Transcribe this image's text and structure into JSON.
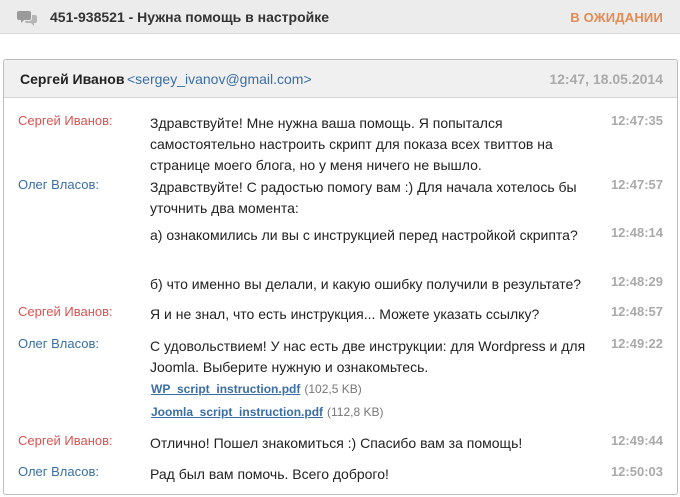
{
  "ticket": {
    "icon": "chat-icon",
    "title": "451-938521 - Нужна помощь в настройке",
    "status": "В ОЖИДАНИИ",
    "status_color": "#e58a55"
  },
  "email_header": {
    "sender_name": "Сергей Иванов",
    "sender_email": "<sergey_ivanov@gmail.com>",
    "datetime": "12:47, 18.05.2014"
  },
  "messages": [
    {
      "author": "Сергей Иванов:",
      "text": "Здравствуйте! Мне нужна ваша помощь. Я попытался самостоятельно настроить скрипт для показа всех твиттов на странице моего блога, но у меня ничего не вышло.",
      "time": "12:47:35"
    },
    {
      "author": "Олег Власов:",
      "text": "Здравствуйте! С радостью помогу вам :) Для начала хотелось бы уточнить два момента:",
      "time": "12:47:57"
    },
    {
      "author": "",
      "text": "а) ознакомились ли вы с инструкцией перед настройкой скрипта?",
      "time": "12:48:14"
    },
    {
      "author": "",
      "text": "б) что именно вы делали, и какую ошибку получили в результате?",
      "time": "12:48:29"
    },
    {
      "author": "Сергей Иванов:",
      "text": "Я и не знал, что есть инструкция... Можете указать ссылку?",
      "time": "12:48:57"
    },
    {
      "author": "Олег Власов:",
      "text": "С удовольствием! У нас есть две инструкции: для Wordpress и для Joomla. Выберите нужную и ознакомьтесь.",
      "time": "12:49:22"
    },
    {
      "author": "Сергей Иванов:",
      "text": "Отлично! Пошел знакомиться :) Спасибо вам за помощь!",
      "time": "12:49:44"
    },
    {
      "author": "Олег Власов:",
      "text": "Рад был вам помочь. Всего доброго!",
      "time": "12:50:03"
    }
  ],
  "attachments": [
    {
      "name": "WP_script_instruction.pdf",
      "size": "(102,5 KB)"
    },
    {
      "name": "Joomla_script_instruction.pdf",
      "size": "(112,8 KB)"
    }
  ],
  "colors": {
    "sergey": "#d9534f",
    "oleg": "#3a6ea5",
    "link": "#3a6ea5"
  }
}
